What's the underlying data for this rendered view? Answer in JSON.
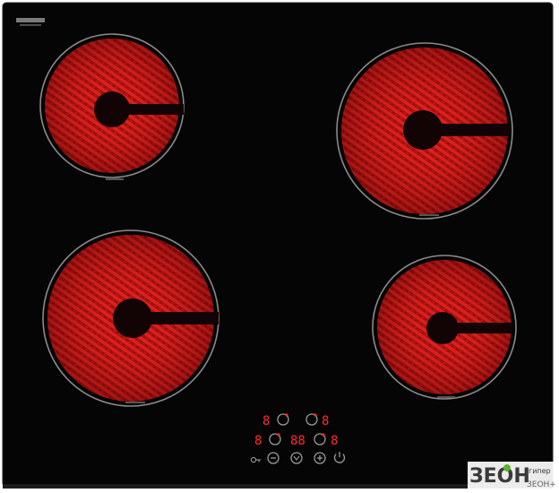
{
  "brand": "",
  "colors": {
    "glass": "#050505",
    "zone_outline": "#8a8a8a",
    "element_red": "#e0201e",
    "element_dark": "#9c0d0d",
    "core": "#120404",
    "display_red": "#ff2a2a",
    "control_grey": "#9a9a9a"
  },
  "zones": [
    {
      "name": "zone-top-left",
      "label": "",
      "position": "top-left"
    },
    {
      "name": "zone-top-right",
      "label": "",
      "position": "top-right"
    },
    {
      "name": "zone-bottom-left",
      "label": "",
      "position": "bottom-left"
    },
    {
      "name": "zone-bottom-right",
      "label": "",
      "position": "bottom-right"
    }
  ],
  "controls": {
    "display_top_left": "8",
    "display_top_right": "8",
    "display_mid_left": "8",
    "display_mid_center": "88",
    "display_mid_right": "8",
    "icons": [
      "lock-icon",
      "minus-icon",
      "timer-icon",
      "plus-icon",
      "power-icon"
    ]
  },
  "watermark": {
    "main": "ЗЕОН",
    "sub_top": "гипер",
    "sub_bottom": "ЗЕОН+"
  }
}
